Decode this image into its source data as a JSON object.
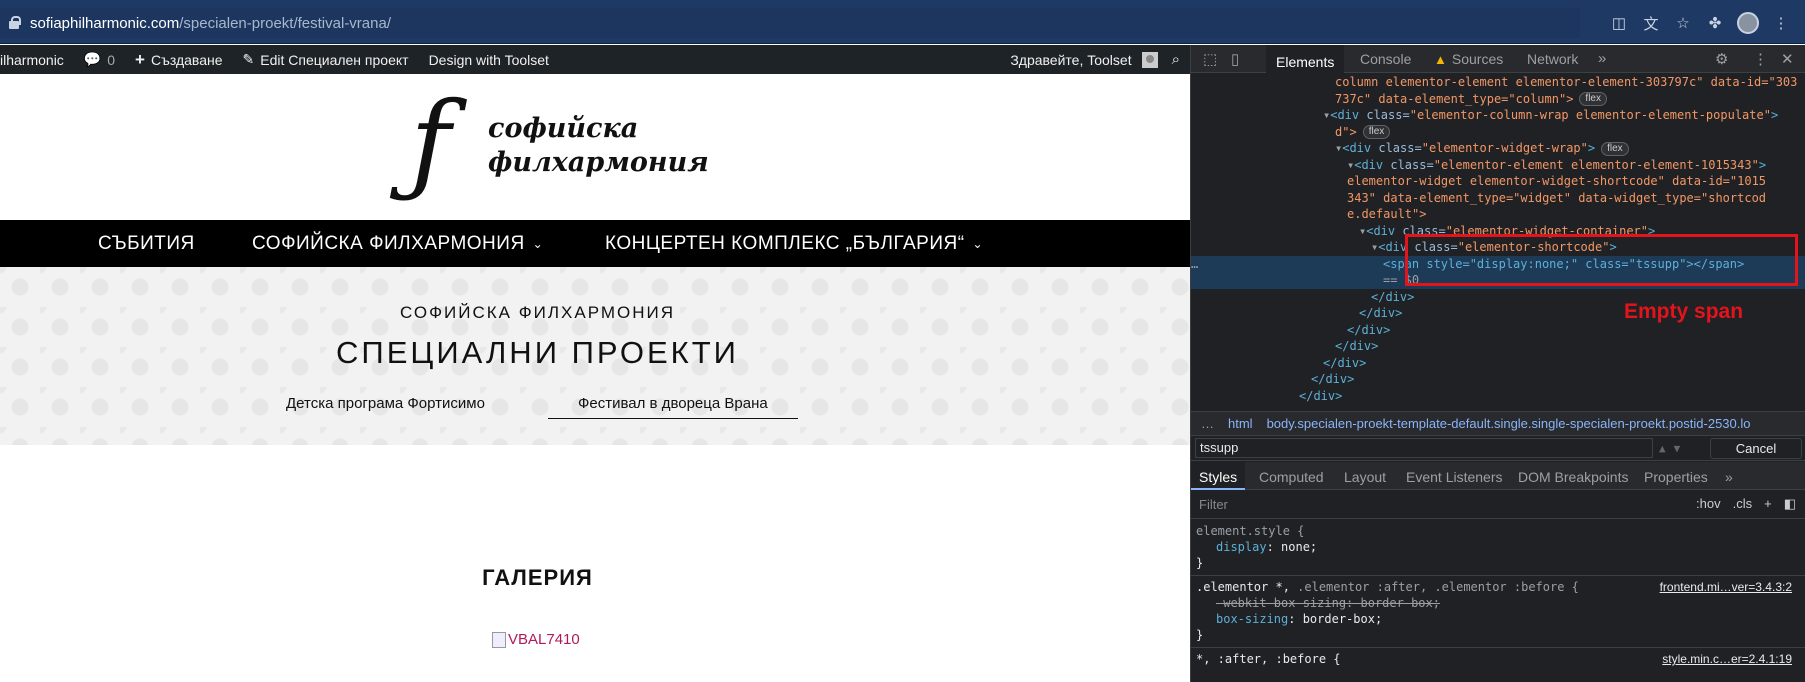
{
  "browser": {
    "url_host": "sofiaphilharmonic.com",
    "url_path": "/specialen-proekt/festival-vrana/"
  },
  "admin_bar": {
    "site": "ilharmonic",
    "comments_count": "0",
    "create": "Създаване",
    "edit": "Edit Специален проект",
    "design": "Design with Toolset",
    "greeting": "Здравейте, Toolset"
  },
  "logo": {
    "glyph": "ƒ",
    "line1": "софийска",
    "line2": "филхармония"
  },
  "nav": {
    "items": [
      {
        "label": "СЪБИТИЯ",
        "has_dropdown": false
      },
      {
        "label": "СОФИЙСКА ФИЛХАРМОНИЯ",
        "has_dropdown": true
      },
      {
        "label": "КОНЦЕРТЕН КОМПЛЕКС „БЪЛГАРИЯ“",
        "has_dropdown": true
      }
    ]
  },
  "hero": {
    "subtitle": "СОФИЙСКА ФИЛХАРМОНИЯ",
    "title": "СПЕЦИАЛНИ ПРОЕКТИ",
    "links": [
      {
        "label": "Детска програма Фортисимо",
        "active": false
      },
      {
        "label": "Фестивал в двореца Врана",
        "active": true
      }
    ]
  },
  "gallery": {
    "title": "ГАЛЕРИЯ",
    "image_alt": "VBAL7410"
  },
  "devtools": {
    "tabs": [
      "Elements",
      "Console",
      "Sources",
      "Network"
    ],
    "active_tab": "Elements",
    "dom_lines": [
      {
        "indent": 12,
        "text_tail": "column elementor-element elementor-element-303797c\" data-id=\"303",
        "kind": "text"
      },
      {
        "indent": 12,
        "text_tail": "737c\" data-element_type=\"column\">",
        "badge": "flex",
        "kind": "text"
      },
      {
        "indent": 11,
        "open": "div",
        "cls": "elementor-column-wrap elementor-element-populate",
        "kind": "tag"
      },
      {
        "indent": 12,
        "text_tail": "d\">",
        "badge": "flex",
        "kind": "text"
      },
      {
        "indent": 12,
        "open": "div",
        "cls": "elementor-widget-wrap",
        "badge": "flex",
        "kind": "tag"
      },
      {
        "indent": 13,
        "open": "div",
        "cls": "elementor-element elementor-element-1015343",
        "kind": "tag"
      },
      {
        "indent": 13,
        "text_tail": "elementor-widget elementor-widget-shortcode\" data-id=\"1015",
        "kind": "text"
      },
      {
        "indent": 13,
        "text_tail": "343\" data-element_type=\"widget\" data-widget_type=\"shortcod",
        "kind": "text"
      },
      {
        "indent": 13,
        "text_tail": "e.default\">",
        "kind": "text"
      },
      {
        "indent": 14,
        "open": "div",
        "cls": "elementor-widget-container",
        "kind": "tag"
      },
      {
        "indent": 15,
        "open": "div",
        "cls": "elementor-shortcode",
        "kind": "tag"
      },
      {
        "indent": 16,
        "text_tail": "<span style=\"display:none;\" class=\"tssupp\"></span>",
        "kind": "selected"
      },
      {
        "indent": 16,
        "text_tail": "== $0",
        "kind": "selected2"
      },
      {
        "indent": 15,
        "text_tail": "</div>",
        "kind": "close"
      },
      {
        "indent": 14,
        "text_tail": "</div>",
        "kind": "close"
      },
      {
        "indent": 13,
        "text_tail": "</div>",
        "kind": "close"
      },
      {
        "indent": 12,
        "text_tail": "</div>",
        "kind": "close"
      },
      {
        "indent": 11,
        "text_tail": "</div>",
        "kind": "close"
      },
      {
        "indent": 10,
        "text_tail": "</div>",
        "kind": "close"
      },
      {
        "indent": 9,
        "text_tail": "</div>",
        "kind": "close"
      }
    ],
    "annotation": "Empty span",
    "breadcrumb_html": "html",
    "breadcrumb_body": "body.specialen-proekt-template-default.single.single-specialen-proekt.postid-2530.lo",
    "search_value": "tssupp",
    "cancel_label": "Cancel",
    "style_tabs": [
      "Styles",
      "Computed",
      "Layout",
      "Event Listeners",
      "DOM Breakpoints",
      "Properties"
    ],
    "filter_placeholder": "Filter",
    "filter_hov": ":hov",
    "filter_cls": ".cls",
    "rules": {
      "r1_selector": "element.style {",
      "r1_prop": "display",
      "r1_value": "none;",
      "r2_selector_a": ".elementor *,",
      "r2_selector_b": " .elementor :after, .elementor :before {",
      "r2_source": "frontend.mi…ver=3.4.3:2",
      "r2_strike": "-webkit-box-sizing: border-box;",
      "r2_prop": "box-sizing",
      "r2_value": "border-box;",
      "r3_selector": "*, :after, :before {",
      "r3_source": "style.min.c…er=2.4.1:19",
      "close": "}"
    }
  }
}
